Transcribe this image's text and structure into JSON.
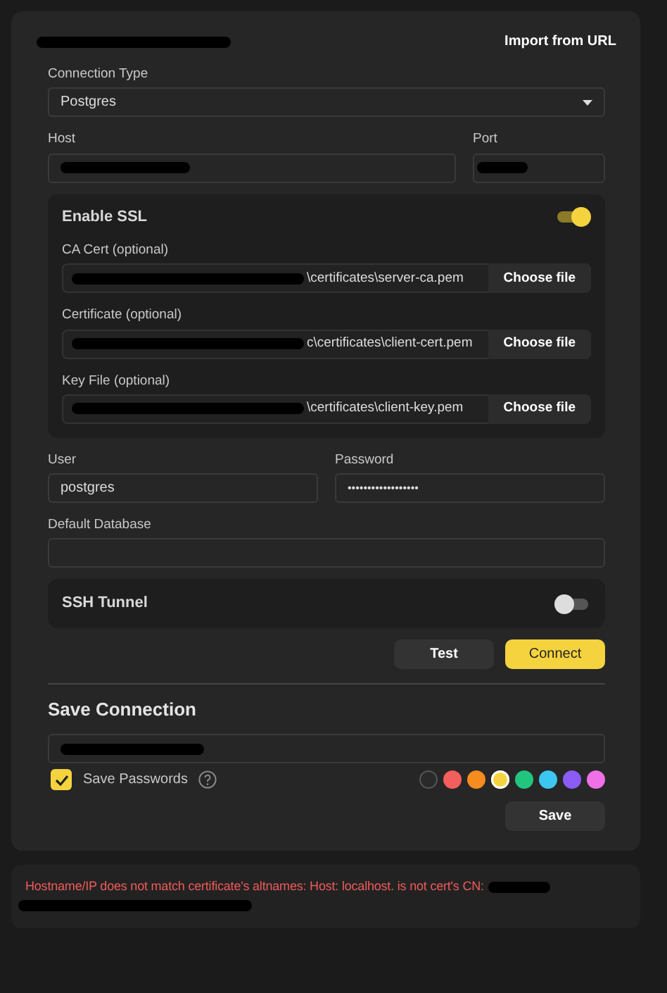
{
  "header": {
    "import_link": "Import from URL"
  },
  "connection_type": {
    "label": "Connection Type",
    "value": "Postgres"
  },
  "host": {
    "label": "Host"
  },
  "port": {
    "label": "Port"
  },
  "ssl": {
    "title": "Enable SSL",
    "on": true,
    "files": [
      {
        "label": "CA Cert (optional)",
        "value": "\\certificates\\server-ca.pem",
        "button": "Choose file"
      },
      {
        "label": "Certificate (optional)",
        "value": "c\\certificates\\client-cert.pem",
        "button": "Choose file"
      },
      {
        "label": "Key File (optional)",
        "value": "\\certificates\\client-key.pem",
        "button": "Choose file"
      }
    ]
  },
  "user": {
    "label": "User",
    "value": "postgres"
  },
  "password": {
    "label": "Password",
    "value": "••••••••••••••••••"
  },
  "default_database": {
    "label": "Default Database"
  },
  "ssh": {
    "title": "SSH Tunnel",
    "on": false
  },
  "buttons": [
    {
      "label": "Test",
      "kind": "secondary"
    },
    {
      "label": "Connect",
      "kind": "primary"
    }
  ],
  "save": {
    "title": "Save Connection",
    "save_passwords": {
      "label": "Save Passwords",
      "checked": true
    },
    "colors": [
      {
        "color": "#2a2a2a",
        "selected": false
      },
      {
        "color": "#f25f5c",
        "selected": false
      },
      {
        "color": "#f68b1f",
        "selected": false
      },
      {
        "color": "#f5d33f",
        "selected": true
      },
      {
        "color": "#22c57e",
        "selected": false
      },
      {
        "color": "#3cc7f0",
        "selected": false
      },
      {
        "color": "#8b5cf6",
        "selected": false
      },
      {
        "color": "#f070e8",
        "selected": false
      }
    ],
    "button": "Save"
  },
  "error": {
    "message": "Hostname/IP does not match certificate's altnames: Host: localhost. is not cert's CN:"
  }
}
